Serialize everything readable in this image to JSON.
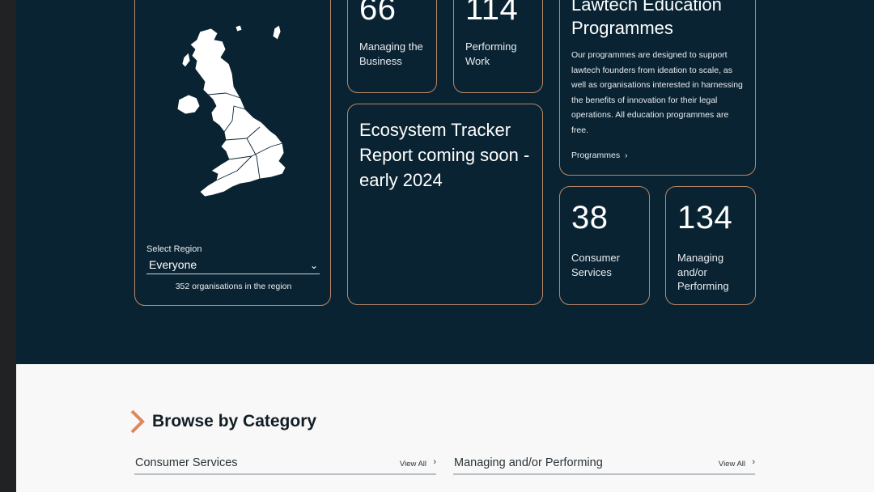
{
  "stats": {
    "managing_business": {
      "value": "66",
      "label": "Managing the Business"
    },
    "performing_work": {
      "value": "114",
      "label": "Performing Work"
    },
    "consumer_services": {
      "value": "38",
      "label": "Consumer Services"
    },
    "managing_performing": {
      "value": "134",
      "label": "Managing and/or Performing"
    }
  },
  "region": {
    "select_label": "Select Region",
    "selected": "Everyone",
    "count_text": "352 organisations in the region"
  },
  "tracker": {
    "title": "Ecosystem Tracker Report coming soon - early 2024"
  },
  "education": {
    "title": "Lawtech Education Programmes",
    "body": "Our programmes are designed to support lawtech founders from ideation to scale, as well as organisations interested in harnessing the benefits of innovation for their legal operations. All education programmes are free.",
    "link": "Programmes"
  },
  "browse": {
    "title": "Browse by Category",
    "categories": [
      {
        "name": "Consumer Services",
        "view_all": "View All"
      },
      {
        "name": "Managing and/or Performing",
        "view_all": "View All"
      }
    ]
  },
  "colors": {
    "dark_bg": "#0a2332",
    "card_border": "#b9876a",
    "accent": "#e0875a",
    "light_bg": "#f8f8f8"
  },
  "icons": {
    "uk_map": "uk-map-icon",
    "chevron": "chevron-right-icon",
    "dropdown": "chevron-down-icon"
  }
}
